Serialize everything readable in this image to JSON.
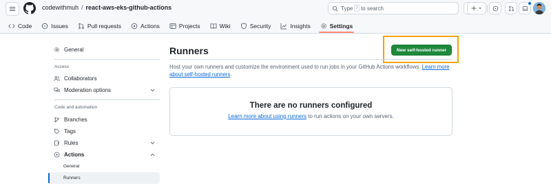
{
  "header": {
    "owner": "codewithmuh",
    "separator": "/",
    "repo": "react-aws-eks-github-actions",
    "search_prefix": "Type",
    "search_key": "/",
    "search_suffix": "to search"
  },
  "tabs": [
    {
      "label": "Code",
      "icon": "code-icon"
    },
    {
      "label": "Issues",
      "icon": "issue-icon"
    },
    {
      "label": "Pull requests",
      "icon": "pull-request-icon"
    },
    {
      "label": "Actions",
      "icon": "play-icon"
    },
    {
      "label": "Projects",
      "icon": "table-icon"
    },
    {
      "label": "Wiki",
      "icon": "book-icon"
    },
    {
      "label": "Security",
      "icon": "shield-icon"
    },
    {
      "label": "Insights",
      "icon": "graph-icon"
    },
    {
      "label": "Settings",
      "icon": "gear-icon",
      "active": true
    }
  ],
  "sidebar": {
    "general": "General",
    "access_heading": "Access",
    "collaborators": "Collaborators",
    "moderation": "Moderation options",
    "code_heading": "Code and automation",
    "branches": "Branches",
    "tags": "Tags",
    "rules": "Rules",
    "actions": "Actions",
    "actions_general": "General",
    "actions_runners": "Runners"
  },
  "main": {
    "title": "Runners",
    "new_runner_button": "New self-hosted runner",
    "description": "Host your own runners and customize the environment used to run jobs in your GitHub Actions workflows.",
    "description_link": "Learn more about self-hosted runners",
    "description_end": ".",
    "empty_title": "There are no runners configured",
    "empty_link": "Learn more about using runners",
    "empty_suffix": "to run actions on your own servers."
  },
  "colors": {
    "accent_orange": "#fd8c73",
    "primary_green": "#1f883d",
    "link_blue": "#0969da",
    "highlight_box": "#f0a400"
  }
}
